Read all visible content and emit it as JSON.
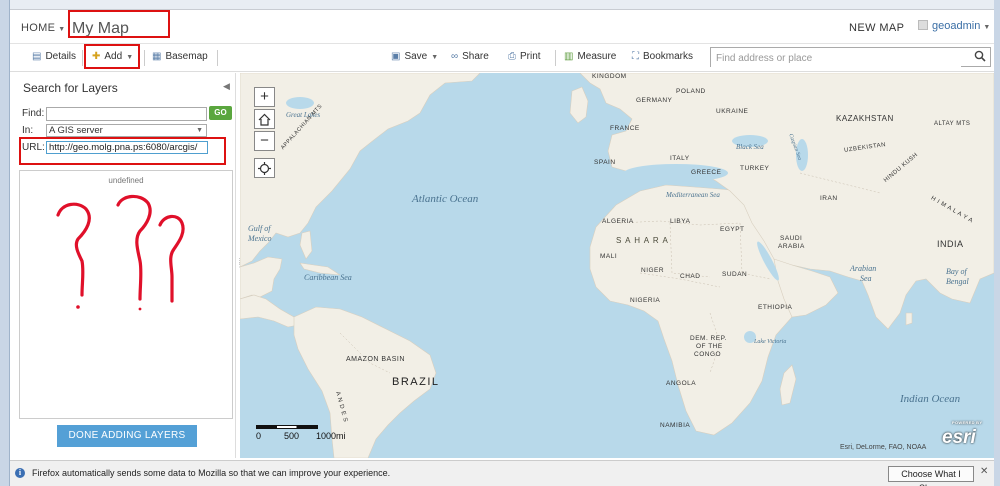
{
  "header": {
    "home_label": "HOME",
    "title": "My Map",
    "new_map_label": "NEW MAP",
    "user": "geoadmin"
  },
  "toolbar": {
    "details": "Details",
    "add": "Add",
    "basemap": "Basemap",
    "save": "Save",
    "share": "Share",
    "print": "Print",
    "measure": "Measure",
    "bookmarks": "Bookmarks",
    "search_placeholder": "Find address or place"
  },
  "panel": {
    "title": "Search for Layers",
    "find_label": "Find:",
    "go_label": "GO",
    "in_label": "In:",
    "in_value": "A GIS server",
    "url_label": "URL:",
    "url_value": "http://geo.molg.pna.ps:6080/arcgis/",
    "result_text": "undefined",
    "done_label": "DONE ADDING LAYERS"
  },
  "map": {
    "zoom_in": "+",
    "zoom_out": "−",
    "scale": {
      "t0": "0",
      "t1": "500",
      "t2": "1000mi"
    },
    "attribution": "Esri, DeLorme, FAO, NOAA",
    "esri_powered": "POWERED BY",
    "esri_logo": "esri",
    "labels": {
      "kingdom": "KINGDOM",
      "poland": "POLAND",
      "germany": "GERMANY",
      "ukraine": "UKRAINE",
      "kazakhstan": "KAZAKHSTAN",
      "france": "FRANCE",
      "spain": "SPAIN",
      "italy": "ITALY",
      "greece": "GREECE",
      "turkey": "TURKEY",
      "black_sea": "Black Sea",
      "caspian": "Caspian Sea",
      "altay": "ALTAY MTS",
      "uzbekistan": "UZBEKISTAN",
      "hindu_kush": "HINDU KUSH",
      "himalaya": "H I M A L A Y A",
      "iran": "IRAN",
      "india": "INDIA",
      "med": "Mediterranean Sea",
      "atlantic": "Atlantic Ocean",
      "great_lakes": "Great Lakes",
      "appalachian": "APPALACHIAN MTS",
      "gulf_mexico_1": "Gulf of",
      "gulf_mexico_2": "Mexico",
      "caribbean": "Caribbean Sea",
      "algeria": "ALGERIA",
      "libya": "LIBYA",
      "egypt": "EGYPT",
      "sahara": "S A H A R A",
      "mali": "MALI",
      "niger": "NIGER",
      "chad": "CHAD",
      "sudan": "SUDAN",
      "saudi_1": "SAUDI",
      "saudi_2": "ARABIA",
      "arabian_1": "Arabian",
      "arabian_2": "Sea",
      "bengal_1": "Bay of",
      "bengal_2": "Bengal",
      "nigeria": "NIGERIA",
      "ethiopia": "ETHIOPIA",
      "drc_1": "DEM. REP.",
      "drc_2": "OF THE",
      "drc_3": "CONGO",
      "lake_victoria": "Lake Victoria",
      "amazon": "AMAZON BASIN",
      "brazil": "BRAZIL",
      "andes": "A N D E S",
      "angola": "ANGOLA",
      "namibia": "NAMIBIA",
      "indian_ocean": "Indian Ocean"
    }
  },
  "notification": {
    "message": "Firefox automatically sends some data to Mozilla so that we can improve your experience.",
    "button": "Choose What I Share",
    "close": "✕"
  },
  "colors": {
    "water": "#b8d9ea",
    "land": "#f2efe6",
    "accent": "#54a0d6",
    "go": "#5aa63e",
    "highlight": "#dd1111"
  }
}
